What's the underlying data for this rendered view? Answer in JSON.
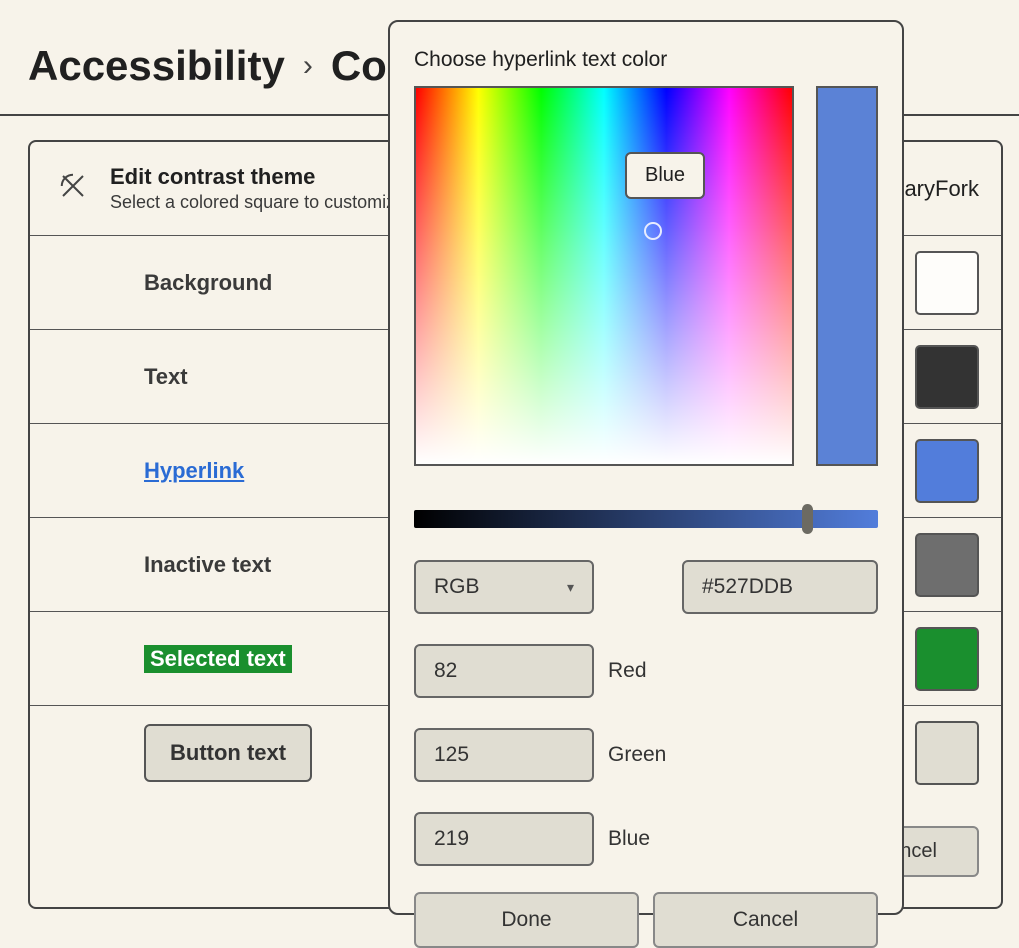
{
  "breadcrumb": {
    "parent": "Accessibility",
    "separator": "›",
    "current": "Contrast themes"
  },
  "theme_card": {
    "title": "Edit contrast theme",
    "subtitle": "Select a colored square to customize",
    "theme_name_tail": "naryFork",
    "rows": [
      {
        "label": "Background",
        "swatch": "#fefdfa",
        "style": "plain"
      },
      {
        "label": "Text",
        "swatch": "#333333",
        "style": "plain"
      },
      {
        "label": "Hyperlink",
        "swatch": "#527ddb",
        "style": "hyperlink"
      },
      {
        "label": "Inactive text",
        "swatch": "#6e6e6e",
        "style": "plain"
      },
      {
        "label": "Selected text",
        "swatch": "#1a8f2e",
        "style": "selected"
      },
      {
        "label": "Button text",
        "swatch": "#e0ddd2",
        "style": "button"
      }
    ],
    "footer": {
      "cancel": "Cancel"
    }
  },
  "dialog": {
    "title": "Choose hyperlink text color",
    "tooltip": "Blue",
    "mode": "RGB",
    "hex": "#527DDB",
    "red": {
      "value": "82",
      "label": "Red"
    },
    "green": {
      "value": "125",
      "label": "Green"
    },
    "blue": {
      "value": "219",
      "label": "Blue"
    },
    "done": "Done",
    "cancel": "Cancel"
  }
}
